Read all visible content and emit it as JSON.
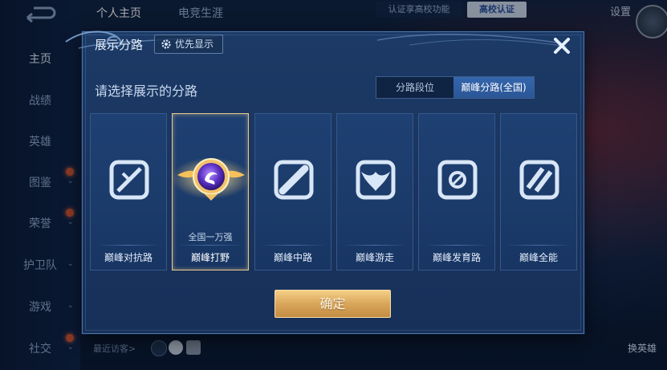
{
  "sidebar": {
    "items": [
      {
        "label": "主页",
        "active": true
      },
      {
        "label": "战绩"
      },
      {
        "label": "英雄"
      },
      {
        "label": "图鉴"
      },
      {
        "label": "荣誉"
      },
      {
        "label": "护卫队"
      },
      {
        "label": "游戏"
      },
      {
        "label": "社交"
      }
    ]
  },
  "topbar": {
    "tabs": [
      "个人主页",
      "电竞生涯"
    ],
    "cert_text": "认证享高校功能",
    "cert_badge": "高校认证",
    "settings": "设置"
  },
  "bottombar": {
    "visitors": "最近访客>",
    "swap_hero": "换英雄"
  },
  "dialog": {
    "title": "展示分路",
    "priority_button": "优先显示",
    "subtitle": "请选择展示的分路",
    "segments": [
      "分路段位",
      "巅峰分路(全国)"
    ],
    "selected_segment": 1,
    "cards": [
      {
        "name": "巅峰对抗路",
        "rank": "",
        "icon": "clash-lane-icon"
      },
      {
        "name": "巅峰打野",
        "rank": "全国一万强",
        "icon": "jungle-medal-icon",
        "selected": true
      },
      {
        "name": "巅峰中路",
        "rank": "",
        "icon": "mid-lane-icon"
      },
      {
        "name": "巅峰游走",
        "rank": "",
        "icon": "roam-icon"
      },
      {
        "name": "巅峰发育路",
        "rank": "",
        "icon": "farm-lane-icon"
      },
      {
        "name": "巅峰全能",
        "rank": "",
        "icon": "all-round-icon"
      }
    ],
    "confirm": "确定"
  },
  "colors": {
    "accent_gold": "#e8c98c",
    "dialog_bg": "#1a3560",
    "segment_active": "#2f5ea3"
  }
}
